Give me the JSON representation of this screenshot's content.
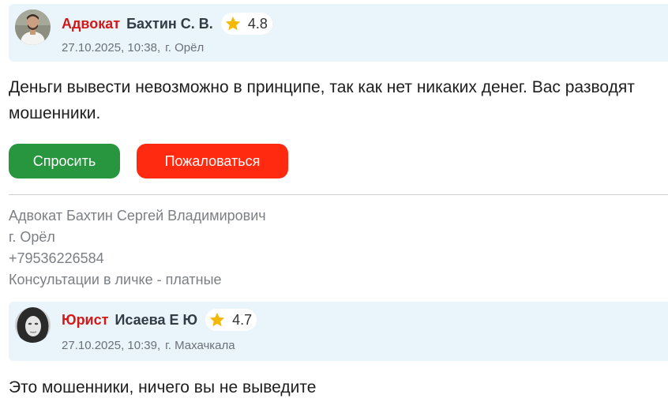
{
  "answers": [
    {
      "role": "Адвокат",
      "name": "Бахтин С. В.",
      "rating": "4.8",
      "date": "27.10.2025, 10:38,",
      "city": "г. Орёл",
      "text": "Деньги вывести невозможно в принципе, так как нет никаких денег. Вас разводят мошенники.",
      "buttons": {
        "ask": "Спросить",
        "complain": "Пожаловаться"
      },
      "signature": [
        "Адвокат Бахтин Сергей Владимирович",
        "г. Орёл",
        "+79536226584",
        "Консультации в личке - платные"
      ]
    },
    {
      "role": "Юрист",
      "name": "Исаева Е Ю",
      "rating": "4.7",
      "date": "27.10.2025, 10:39,",
      "city": "г. Махачкала",
      "text": "Это мошенники, ничего вы не выведите"
    }
  ],
  "colors": {
    "role": "#d21919",
    "header_bg": "#eaf4fb",
    "ask_button": "#27963e",
    "complain_button": "#ff2a0f",
    "star": "#f5b800"
  },
  "icons": {
    "rating": "star-icon",
    "avatar1": "male-avatar",
    "avatar2": "female-avatar"
  }
}
